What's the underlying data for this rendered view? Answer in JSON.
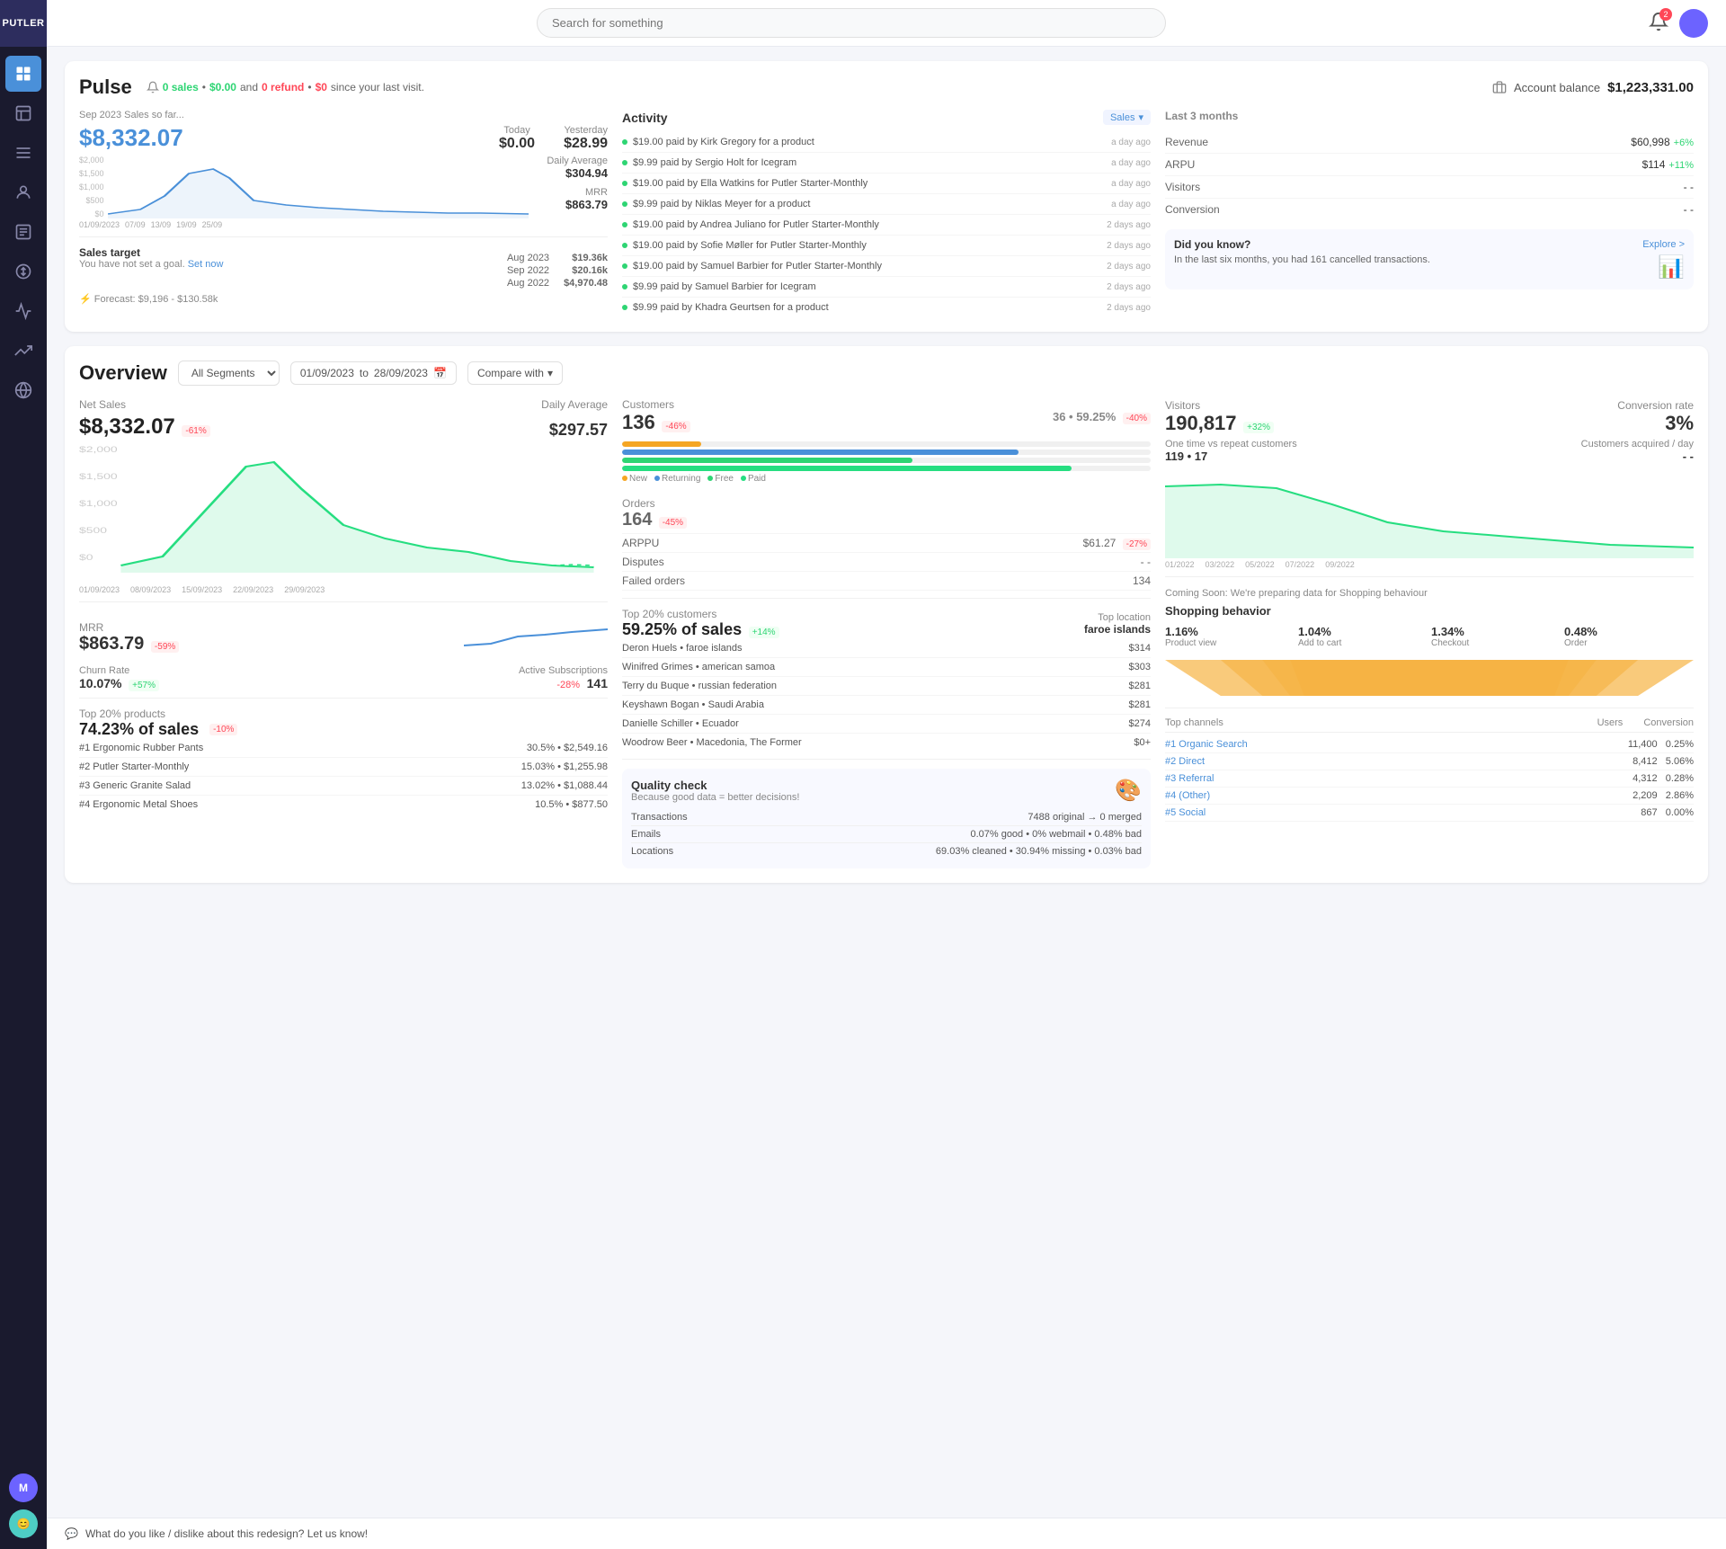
{
  "app": {
    "logo": "PUTLER",
    "search_placeholder": "Search for something"
  },
  "header": {
    "notif_count": "2"
  },
  "pulse": {
    "title": "Pulse",
    "info_sales": "0 sales",
    "info_money": "$0.00",
    "info_refund": "0 refund",
    "info_refund_money": "$0",
    "info_suffix": "since your last visit.",
    "account_balance_label": "Account balance",
    "account_balance_amount": "$1,223,331.00",
    "sales_month": "Sep 2023 Sales so far...",
    "sales_amount": "$8,332.07",
    "today_label": "Today",
    "today_value": "$0.00",
    "yesterday_label": "Yesterday",
    "yesterday_value": "$28.99",
    "daily_avg_label": "Daily Average",
    "daily_avg_value": "$304.94",
    "mrr_label": "MRR",
    "mrr_value": "$863.79",
    "chart_labels": [
      "01/09/2023",
      "07/09/2023",
      "13/09/2023",
      "19/09/2023",
      "25/09/2023"
    ],
    "sales_target_title": "Sales target",
    "sales_target_sub": "You have not set a goal.",
    "set_now": "Set now",
    "target_rows": [
      {
        "period": "Aug 2023",
        "amount": "$19.36k"
      },
      {
        "period": "Sep 2022",
        "amount": "$20.16k"
      },
      {
        "period": "Aug 2022",
        "amount": "$4,970.48"
      }
    ],
    "forecast_text": "Forecast: $9,196 - $130.58k",
    "activity_title": "Activity",
    "activity_badge": "Sales",
    "activity_items": [
      {
        "text": "$19.00 paid by Kirk Gregory for a product",
        "time": "a day ago"
      },
      {
        "text": "$9.99 paid by Sergio Holt for Icegram",
        "time": "a day ago"
      },
      {
        "text": "$19.00 paid by Ella Watkins for Putler Starter-Monthly",
        "time": "a day ago"
      },
      {
        "text": "$9.99 paid by Niklas Meyer for a product",
        "time": "a day ago"
      },
      {
        "text": "$19.00 paid by Andrea Juliano for Putler Starter-Monthly",
        "time": "2 days ago"
      },
      {
        "text": "$19.00 paid by Sofie Møller for Putler Starter-Monthly",
        "time": "2 days ago"
      },
      {
        "text": "$19.00 paid by Samuel Barbier for Putler Starter-Monthly",
        "time": "2 days ago"
      },
      {
        "text": "$9.99 paid by Samuel Barbier for Icegram",
        "time": "2 days ago"
      },
      {
        "text": "$9.99 paid by Khadra Geurtsen for a product",
        "time": "2 days ago"
      }
    ],
    "last3_title": "Last 3 months",
    "last3_rows": [
      {
        "label": "Revenue",
        "value": "$60,998",
        "change": "+6%",
        "positive": true
      },
      {
        "label": "ARPU",
        "value": "$114",
        "change": "+11%",
        "positive": true
      },
      {
        "label": "Visitors",
        "value": "- -",
        "change": "",
        "positive": null
      },
      {
        "label": "Conversion",
        "value": "- -",
        "change": "",
        "positive": null
      }
    ],
    "dyk_title": "Did you know?",
    "dyk_explore": "Explore >",
    "dyk_text": "In the last six months, you had 161 cancelled transactions."
  },
  "overview": {
    "title": "Overview",
    "segment_label": "All Segments",
    "date_from": "01/09/2023",
    "date_to": "28/09/2023",
    "compare_label": "Compare with",
    "net_sales_label": "Net Sales",
    "net_sales_value": "$8,332.07",
    "net_sales_change": "-61%",
    "daily_avg_label": "Daily Average",
    "daily_avg_value": "$297.57",
    "chart_labels": [
      "01/09/2023",
      "08/09/2023",
      "15/09/2023",
      "22/09/2023",
      "29/09/2023"
    ],
    "mrr_label": "MRR",
    "mrr_value": "$863.79",
    "mrr_change": "-59%",
    "churn_rate_label": "Churn Rate",
    "churn_rate_value": "10.07%",
    "churn_rate_change": "+57%",
    "active_sub_label": "Active Subscriptions",
    "active_sub_change": "-28%",
    "active_sub_value": "141",
    "top20_products_label": "Top 20% products",
    "top20_products_pct": "74.23% of sales",
    "top20_products_change": "-10%",
    "products": [
      {
        "rank": "#1 Ergonomic Rubber Pants",
        "share": "30.5%",
        "amount": "$2,549.16"
      },
      {
        "rank": "#2 Putler Starter-Monthly",
        "share": "15.03%",
        "amount": "$1,255.98"
      },
      {
        "rank": "#3 Generic Granite Salad",
        "share": "13.02%",
        "amount": "$1,088.44"
      },
      {
        "rank": "#4 Ergonomic Metal Shoes",
        "share": "10.5%",
        "amount": "$877.50"
      }
    ],
    "customers_label": "Customers",
    "customers_value": "136",
    "customers_change": "-46%",
    "customers_right_val": "36 • 59.25%",
    "customers_right_change": "-40%",
    "orders_label": "Orders",
    "orders_value": "164",
    "orders_change": "-45%",
    "bar_new_pct": 15,
    "bar_returning_pct": 75,
    "bar_free_pct": 55,
    "bar_paid_pct": 85,
    "legend_new": "New",
    "legend_returning": "Returning",
    "legend_free": "Free",
    "legend_paid": "Paid",
    "arppu_label": "ARPPU",
    "arppu_value": "$61.27",
    "arppu_change": "-27%",
    "disputes_label": "Disputes",
    "disputes_value": "- -",
    "failed_orders_label": "Failed orders",
    "failed_orders_value": "134",
    "top20_customers_label": "Top 20% customers",
    "top20_customers_pct": "59.25% of sales",
    "top20_customers_change": "+14%",
    "top_location_label": "Top location",
    "top_location_value": "faroe islands",
    "top_customers": [
      {
        "name": "Deron Huels • faroe islands",
        "amount": "$314"
      },
      {
        "name": "Winifred Grimes • american samoa",
        "amount": "$303"
      },
      {
        "name": "Terry du Buque • russian federation",
        "amount": "$281"
      },
      {
        "name": "Keyshawn Bogan • Saudi Arabia",
        "amount": "$281"
      },
      {
        "name": "Danielle Schiller • Ecuador",
        "amount": "$274"
      },
      {
        "name": "Woodrow Beer • Macedonia, The Former",
        "amount": "$0+"
      }
    ],
    "quality_title": "Quality check",
    "quality_sub": "Because good data = better decisions!",
    "quality_transactions": "Transactions",
    "quality_transactions_val": "7488 original → 0 merged",
    "quality_emails": "Emails",
    "quality_emails_val": "0.07% good • 0% webmail • 0.48% bad",
    "quality_locations": "Locations",
    "quality_locations_val": "69.03% cleaned • 30.94% missing • 0.03% bad",
    "visitors_label": "Visitors",
    "visitors_value": "190,817",
    "visitors_change": "+32%",
    "conversion_label": "Conversion rate",
    "conversion_value": "3%",
    "one_time_label": "One time vs repeat customers",
    "one_time_value": "119 • 17",
    "acquired_label": "Customers acquired / day",
    "acquired_value": "- -",
    "visitors_chart_labels": [
      "01/2022",
      "03/2022",
      "05/2022",
      "07/2022",
      "09/2022"
    ],
    "coming_soon_text": "Coming Soon: We're preparing data for Shopping behaviour",
    "shopping_title": "Shopping behavior",
    "shopping_metrics": [
      {
        "val": "1.16%",
        "label": "Product view"
      },
      {
        "val": "1.04%",
        "label": "Add to cart"
      },
      {
        "val": "1.34%",
        "label": "Checkout"
      },
      {
        "val": "0.48%",
        "label": "Order"
      }
    ],
    "channels_title": "Top channels",
    "channels_users_label": "Users",
    "channels_conversion_label": "Conversion",
    "channels": [
      {
        "name": "#1 Organic Search",
        "users": "11,400",
        "conversion": "0.25%"
      },
      {
        "name": "#2 Direct",
        "users": "8,412",
        "conversion": "5.06%"
      },
      {
        "name": "#3 Referral",
        "users": "4,312",
        "conversion": "0.28%"
      },
      {
        "name": "#4 (Other)",
        "users": "2,209",
        "conversion": "2.86%"
      },
      {
        "name": "#5 Social",
        "users": "867",
        "conversion": "0.00%"
      }
    ]
  },
  "feedback": {
    "text": "What do you like / dislike about this redesign? Let us know!"
  },
  "icons": {
    "dashboard": "⊞",
    "analytics": "◫",
    "reports": "≡",
    "customers": "👤",
    "orders": "📋",
    "transactions": "↔",
    "chart": "📊",
    "trending": "↗",
    "globe": "🌐",
    "bell": "🔔",
    "search": "🔍",
    "calendar": "📅",
    "chevron_down": "▾"
  }
}
